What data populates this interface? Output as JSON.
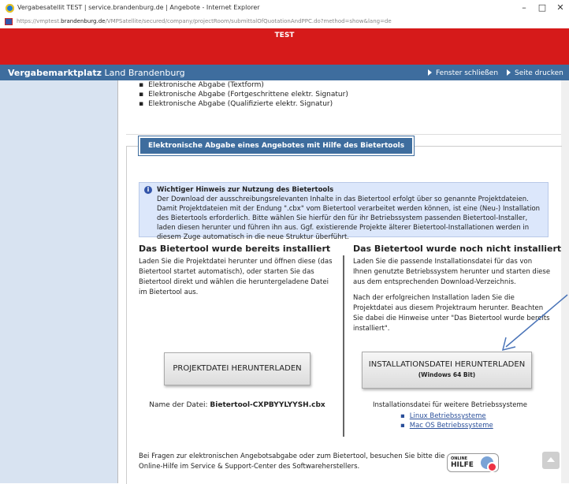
{
  "window": {
    "title": "Vergabesatellit TEST | service.brandenburg.de | Angebote - Internet Explorer",
    "minimize": "–",
    "maximize": "□",
    "close": "✕"
  },
  "address_bar": {
    "url_prefix": "https://vmptest.",
    "url_host": "brandenburg.de",
    "url_path": "/VMPSatellite/secured/company/projectRoom/submittalOfQuotationAndPPC.do?method=show&lang=de"
  },
  "banner": {
    "label": "TEST",
    "color": "#d61a1a"
  },
  "nav": {
    "brand_bold": "Vergabemarktplatz",
    "brand_rest": " Land Brandenburg",
    "close_window": "Fenster schließen",
    "print_page": "Seite drucken",
    "color": "#3e6d9e"
  },
  "submission_types": [
    "Elektronische Abgabe (Textform)",
    "Elektronische Abgabe (Fortgeschrittene elektr. Signatur)",
    "Elektronische Abgabe (Qualifizierte elektr. Signatur)"
  ],
  "section": {
    "heading": "Elektronische Abgabe eines Angebotes mit Hilfe des Bietertools",
    "info_title": "Wichtiger Hinweis zur Nutzung des Bietertools",
    "info_text": "Der Download der ausschreibungsrelevanten Inhalte in das Bietertool erfolgt über so genannte Projektdateien. Damit Projektdateien mit der Endung \".cbx\" vom Bietertool verarbeitet werden können, ist eine (Neu-) Installation des Bietertools erforderlich. Bitte wählen Sie hierfür den für ihr Betriebssystem passenden Bietertool-Installer, laden diesen herunter und führen ihn aus. Ggf. existierende Projekte älterer Bietertool-Installationen werden in diesem Zuge automatisch in die neue Struktur überführt."
  },
  "left_col": {
    "heading": "Das Bietertool wurde bereits installiert",
    "text": "Laden Sie die Projektdatei herunter und öffnen diese (das Bietertool startet automatisch), oder starten Sie das Bietertool direkt und wählen die heruntergeladene Datei im Bietertool aus.",
    "button": "PROJEKTDATEI HERUNTERLADEN",
    "filename_label": "Name der Datei: ",
    "filename": "Bietertool-CXPBYYLYYSH.cbx"
  },
  "right_col": {
    "heading": "Das Bietertool wurde noch nicht installiert",
    "text1": "Laden Sie die passende Installationsdatei für das von Ihnen genutzte Betriebssystem herunter und starten diese aus dem entsprechenden Download-Verzeichnis.",
    "text2": "Nach der erfolgreichen Installation laden Sie die Projektdatei aus diesem Projektraum herunter. Beachten Sie dabei die Hinweise unter \"Das Bietertool wurde bereits installiert\".",
    "button": "INSTALLATIONSDATEI HERUNTERLADEN",
    "button_sub": "(Windows 64 Bit)",
    "other_label": "Installationsdatei für weitere Betriebssysteme",
    "links": [
      "Linux Betriebssysteme",
      "Mac OS Betriebssysteme"
    ]
  },
  "footer": {
    "text": "Bei Fragen zur elektronischen Angebotsabgabe oder zum Bietertool, besuchen Sie bitte die Online-Hilfe im Service & Support-Center des Softwareherstellers.",
    "help_small": "ONLINE",
    "help_big": "HILFE"
  }
}
